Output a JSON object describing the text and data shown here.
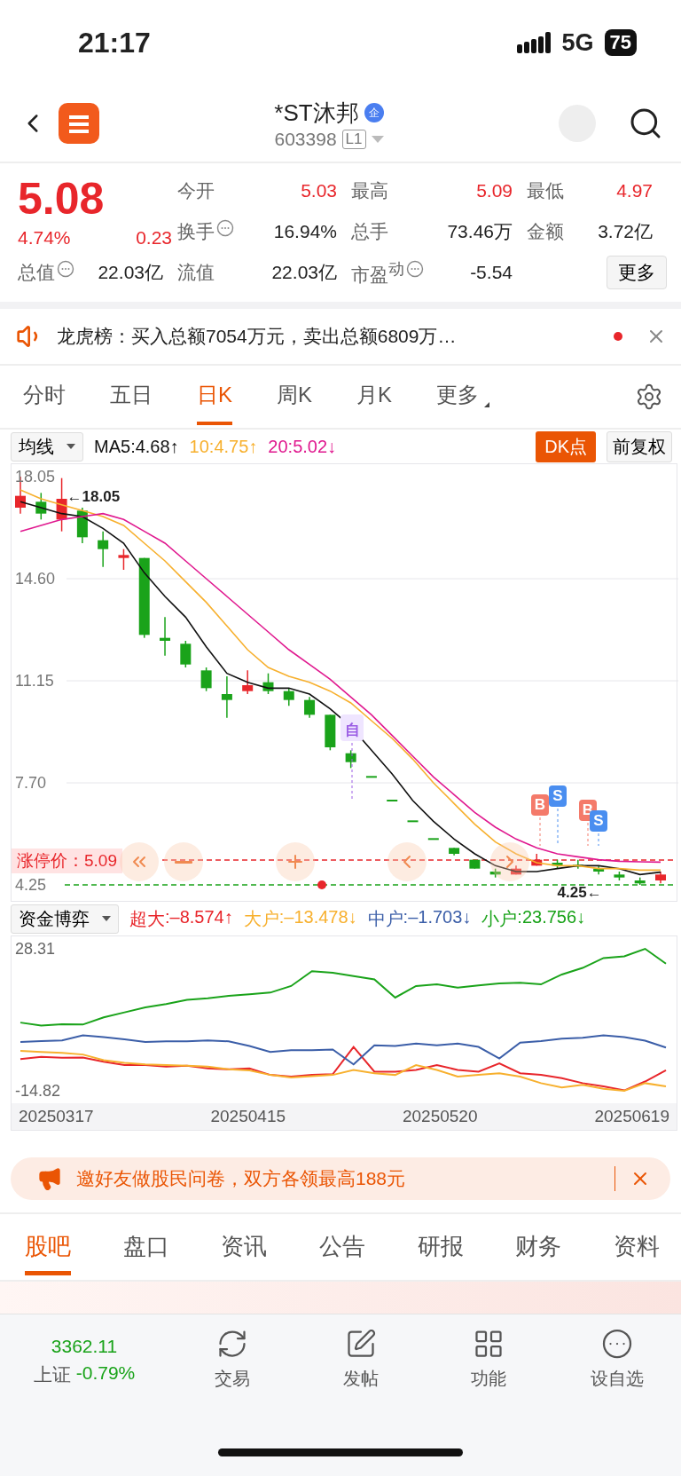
{
  "status_bar": {
    "time": "21:17",
    "network": "5G",
    "battery": "75"
  },
  "header": {
    "title": "*ST沐邦",
    "badge": "企",
    "code": "603398",
    "level_tag": "L1"
  },
  "quote": {
    "price": "5.08",
    "change_pct": "4.74%",
    "change": "0.23",
    "stats": [
      {
        "label": "今开",
        "value": "5.03",
        "color": "#e8262b",
        "info": false
      },
      {
        "label": "最高",
        "value": "5.09",
        "color": "#e8262b",
        "info": false
      },
      {
        "label": "最低",
        "value": "4.97",
        "color": "#e8262b",
        "info": false
      },
      {
        "label": "换手",
        "value": "16.94%",
        "color": "#222222",
        "info": true
      },
      {
        "label": "总手",
        "value": "73.46万",
        "color": "#222222",
        "info": false
      },
      {
        "label": "金额",
        "value": "3.72亿",
        "color": "#222222",
        "info": false
      },
      {
        "label": "总值",
        "value": "22.03亿",
        "color": "#222222",
        "info": true
      },
      {
        "label": "流值",
        "value": "22.03亿",
        "color": "#222222",
        "info": false
      },
      {
        "label": "市盈$^{动}$",
        "value": "-5.54",
        "color": "#222222",
        "info": true
      }
    ],
    "more_button": "更多"
  },
  "notice": {
    "text": "龙虎榜：买入总额7054万元，卖出总额6809万…",
    "unread": true
  },
  "period_tabs": [
    {
      "label": "分时",
      "selected": false,
      "kind": "tab"
    },
    {
      "label": "五日",
      "selected": false,
      "kind": "tab"
    },
    {
      "label": "日K",
      "selected": true,
      "kind": "tab"
    },
    {
      "label": "周K",
      "selected": false,
      "kind": "tab"
    },
    {
      "label": "月K",
      "selected": false,
      "kind": "tab"
    },
    {
      "label": "更多",
      "selected": false,
      "kind": "menu"
    }
  ],
  "ma_legend": {
    "selector": "均线",
    "readings": [
      ":4.68↑",
      ":4.75↑",
      ":5.02↓"
    ],
    "dk_button": "DK点",
    "adjust_button": "前复权"
  },
  "k_chart": {
    "high_label": "←18.05",
    "low_label": "4.25←",
    "markers": [
      {
        "text": "自",
        "kind": "auto"
      },
      {
        "text": "B",
        "kind": "buy"
      },
      {
        "text": "S",
        "kind": "sell"
      },
      {
        "text": "B",
        "kind": "buy"
      },
      {
        "text": "S",
        "kind": "sell"
      }
    ],
    "chart_data": {
      "type": "candlestick",
      "ylim": [
        3.68,
        18.5
      ],
      "grid": true,
      "ref_lines": [
        {
          "axis": "y",
          "value": 5.09,
          "label": "涨停价：5.09",
          "color": "#e8262b"
        },
        {
          "axis": "y",
          "value": 4.25,
          "color": "#1aa31a"
        }
      ],
      "yticks": [
        {
          "value": 4.25,
          "label": "4.25"
        },
        {
          "value": 7.7,
          "label": "7.70"
        },
        {
          "value": 11.15,
          "label": "11.15"
        },
        {
          "value": 14.6,
          "label": "14.60"
        },
        {
          "value": 18.05,
          "label": "18.05"
        }
      ],
      "ohlc": [
        [
          17.0,
          18.05,
          16.8,
          17.4
        ],
        [
          17.2,
          17.5,
          16.6,
          16.8
        ],
        [
          16.6,
          18.0,
          16.2,
          17.3
        ],
        [
          16.9,
          17.0,
          15.8,
          16.0
        ],
        [
          15.9,
          16.2,
          15.0,
          15.6
        ],
        [
          15.3,
          15.6,
          14.9,
          15.4
        ],
        [
          15.3,
          15.3,
          12.6,
          12.7
        ],
        [
          12.6,
          13.3,
          12.0,
          12.5
        ],
        [
          12.4,
          12.5,
          11.6,
          11.7
        ],
        [
          11.5,
          11.6,
          10.8,
          10.9
        ],
        [
          10.7,
          11.3,
          9.9,
          10.5
        ],
        [
          10.8,
          11.5,
          10.7,
          11.0
        ],
        [
          11.1,
          11.4,
          10.7,
          10.8
        ],
        [
          10.8,
          10.9,
          10.3,
          10.5
        ],
        [
          10.5,
          10.6,
          9.9,
          10.0
        ],
        [
          10.0,
          10.0,
          8.8,
          8.9
        ],
        [
          8.7,
          8.8,
          8.2,
          8.4
        ],
        [
          7.9,
          7.9,
          7.9,
          7.9
        ],
        [
          7.1,
          7.1,
          7.1,
          7.1
        ],
        [
          6.4,
          6.4,
          6.4,
          6.4
        ],
        [
          5.8,
          5.8,
          5.8,
          5.8
        ],
        [
          5.5,
          5.5,
          5.25,
          5.3
        ],
        [
          5.1,
          5.1,
          4.8,
          4.8
        ],
        [
          4.7,
          4.8,
          4.5,
          4.6
        ],
        [
          4.6,
          4.9,
          4.6,
          4.8
        ],
        [
          4.9,
          5.3,
          4.9,
          5.1
        ],
        [
          5.0,
          5.1,
          4.8,
          4.9
        ],
        [
          4.9,
          5.1,
          4.8,
          4.9
        ],
        [
          4.8,
          4.9,
          4.6,
          4.7
        ],
        [
          4.6,
          4.7,
          4.4,
          4.5
        ],
        [
          4.4,
          4.5,
          4.25,
          4.3
        ],
        [
          4.4,
          4.7,
          4.3,
          4.6
        ]
      ],
      "series": [
        {
          "name": "MA5",
          "type": "line",
          "color": "#111111",
          "values": [
            17.2,
            17.0,
            16.8,
            16.7,
            16.3,
            15.8,
            14.8,
            14.0,
            13.3,
            12.3,
            11.4,
            11.1,
            10.9,
            10.9,
            10.7,
            10.2,
            9.6,
            8.8,
            8.0,
            7.1,
            6.4,
            5.8,
            5.3,
            4.9,
            4.7,
            4.7,
            4.8,
            4.9,
            4.9,
            4.8,
            4.6,
            4.68
          ]
        },
        {
          "name": "10",
          "type": "line",
          "color": "#f7b02e",
          "values": [
            17.6,
            17.3,
            17.1,
            16.9,
            16.7,
            16.4,
            15.8,
            15.2,
            14.5,
            13.8,
            13.0,
            12.2,
            11.6,
            11.3,
            11.1,
            10.8,
            10.4,
            9.8,
            9.2,
            8.5,
            7.7,
            7.0,
            6.3,
            5.7,
            5.3,
            5.0,
            4.9,
            4.9,
            4.8,
            4.8,
            4.75,
            4.75
          ]
        },
        {
          "name": "20",
          "type": "line",
          "color": "#e0198f",
          "values": [
            16.2,
            16.4,
            16.6,
            16.7,
            16.8,
            16.6,
            16.2,
            15.8,
            15.2,
            14.6,
            14.0,
            13.4,
            12.8,
            12.2,
            11.7,
            11.2,
            10.6,
            10.0,
            9.3,
            8.6,
            7.9,
            7.3,
            6.7,
            6.2,
            5.8,
            5.5,
            5.3,
            5.2,
            5.1,
            5.05,
            5.03,
            5.02
          ]
        }
      ]
    }
  },
  "flow": {
    "selector": "资金博弈",
    "readings": [
      ":–8.574↑",
      ":–13.478↓",
      ":–1.703↓",
      ":23.756↓"
    ],
    "date_labels": [
      "20250317",
      "20250415",
      "20250520",
      "20250619"
    ],
    "chart_data": {
      "type": "line",
      "ylim": [
        -26.95,
        32.35
      ],
      "yticks": [
        {
          "value": -14.82,
          "label": "-14.82"
        },
        {
          "value": 28.31,
          "label": "28.31"
        }
      ],
      "series": [
        {
          "name": "超大",
          "color": "#e8262b",
          "values": [
            -5.2,
            -4.5,
            -4.8,
            -4.7,
            -6.0,
            -7.0,
            -7.0,
            -7.5,
            -7.2,
            -8.0,
            -8.3,
            -8.0,
            -10.0,
            -10.5,
            -10.0,
            -9.8,
            -1.5,
            -9.0,
            -9.0,
            -8.5,
            -7.0,
            -8.5,
            -9.0,
            -6.5,
            -9.5,
            -10.0,
            -11.0,
            -12.5,
            -13.5,
            -14.7,
            -12.0,
            -8.6
          ]
        },
        {
          "name": "大户",
          "color": "#f7b02e",
          "values": [
            -2.7,
            -3.0,
            -3.3,
            -3.8,
            -5.5,
            -6.3,
            -6.8,
            -7.0,
            -7.2,
            -7.5,
            -8.3,
            -8.6,
            -10.0,
            -10.8,
            -10.4,
            -10.0,
            -8.5,
            -9.5,
            -10.0,
            -7.0,
            -8.5,
            -10.5,
            -10.0,
            -9.5,
            -10.5,
            -12.5,
            -13.8,
            -13.0,
            -14.2,
            -14.8,
            -12.5,
            -13.5
          ]
        },
        {
          "name": "中户",
          "color": "#3b5ea8",
          "values": [
            0,
            0.3,
            0.5,
            2.0,
            1.5,
            0.8,
            0,
            0.2,
            0.2,
            0.5,
            0.2,
            -1.2,
            -3.0,
            -2.5,
            -2.5,
            -2.3,
            -6.8,
            -1.0,
            -1.2,
            -0.5,
            -1.0,
            -0.5,
            -1.5,
            -5.0,
            -0.2,
            0.3,
            1.0,
            1.3,
            2.0,
            1.5,
            0.4,
            -1.7
          ]
        },
        {
          "name": "小户",
          "color": "#1aa31a",
          "values": [
            5.9,
            5.0,
            5.4,
            5.3,
            7.5,
            9.0,
            10.5,
            11.5,
            12.8,
            13.3,
            14.0,
            14.5,
            15.0,
            17.0,
            21.5,
            21.0,
            20.0,
            19.0,
            13.5,
            17.0,
            17.5,
            16.5,
            17.2,
            17.8,
            18.0,
            17.5,
            20.5,
            22.5,
            25.5,
            26.0,
            28.3,
            23.8
          ]
        }
      ]
    }
  },
  "promo": {
    "text": "邀好友做股民问卷，双方各领最高188元"
  },
  "content_tabs": [
    {
      "label": "股吧",
      "selected": true
    },
    {
      "label": "盘口",
      "selected": false
    },
    {
      "label": "资讯",
      "selected": false
    },
    {
      "label": "公告",
      "selected": false
    },
    {
      "label": "研报",
      "selected": false
    },
    {
      "label": "财务",
      "selected": false
    },
    {
      "label": "资料",
      "selected": false
    }
  ],
  "bottom_bar": {
    "index_value": "3362.11",
    "index_name": "上证",
    "index_change": "-0.79%",
    "actions": [
      {
        "label": "交易",
        "kind": "trade"
      },
      {
        "label": "发帖",
        "kind": "post"
      },
      {
        "label": "功能",
        "kind": "apps"
      },
      {
        "label": "设自选",
        "kind": "watch"
      }
    ]
  }
}
